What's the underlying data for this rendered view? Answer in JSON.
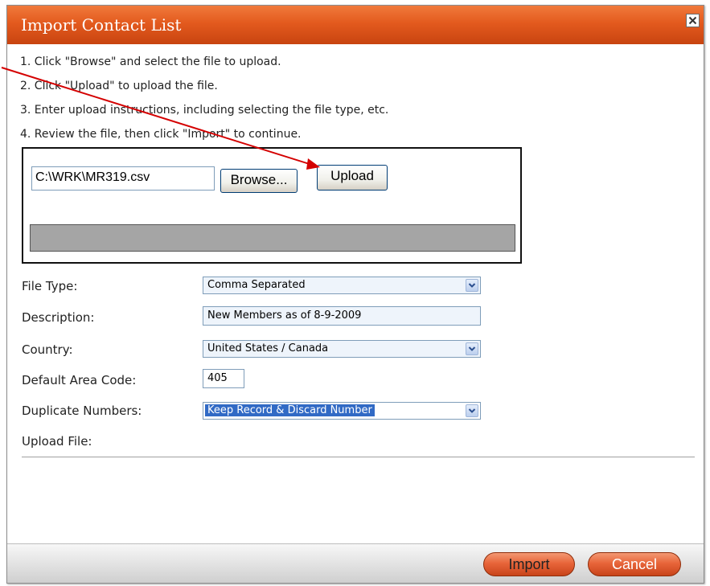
{
  "dialog": {
    "title": "Import Contact List",
    "close_icon": "close-icon"
  },
  "instructions": [
    "1. Click \"Browse\" and select the file to upload.",
    "2. Click \"Upload\" to upload the file.",
    "3. Enter upload instructions, including selecting the file type, etc.",
    "4. Review the file, then click \"Import\" to continue."
  ],
  "upload": {
    "file_path": "C:\\WRK\\MR319.csv",
    "browse_label": "Browse...",
    "upload_label": "Upload"
  },
  "form": {
    "file_type_label": "File Type:",
    "file_type_value": "Comma Separated",
    "description_label": "Description:",
    "description_value": "New Members as of 8-9-2009",
    "country_label": "Country:",
    "country_value": "United States / Canada",
    "area_code_label": "Default Area Code:",
    "area_code_value": "405",
    "duplicates_label": "Duplicate Numbers:",
    "duplicates_value": "Keep Record & Discard Number",
    "upload_file_label": "Upload File:"
  },
  "footer": {
    "import_label": "Import",
    "cancel_label": "Cancel"
  },
  "colors": {
    "title_bar": "#e35a1e",
    "button_orange": "#e8653a",
    "annotation_arrow": "#d40000"
  }
}
